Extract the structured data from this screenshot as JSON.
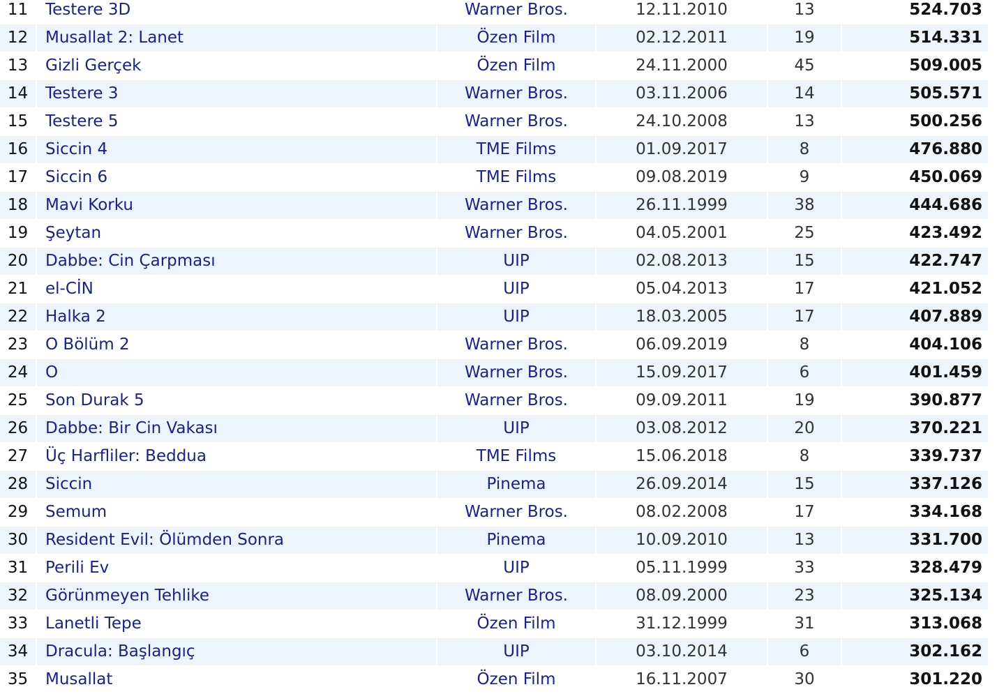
{
  "table": {
    "rows": [
      {
        "rank": "11",
        "title": "Testere 3D",
        "distributor": "Warner Bros.",
        "date": "12.11.2010",
        "weeks": "13",
        "admissions": "524.703"
      },
      {
        "rank": "12",
        "title": "Musallat 2: Lanet",
        "distributor": "Özen Film",
        "date": "02.12.2011",
        "weeks": "19",
        "admissions": "514.331"
      },
      {
        "rank": "13",
        "title": "Gizli Gerçek",
        "distributor": "Özen Film",
        "date": "24.11.2000",
        "weeks": "45",
        "admissions": "509.005"
      },
      {
        "rank": "14",
        "title": "Testere 3",
        "distributor": "Warner Bros.",
        "date": "03.11.2006",
        "weeks": "14",
        "admissions": "505.571"
      },
      {
        "rank": "15",
        "title": "Testere 5",
        "distributor": "Warner Bros.",
        "date": "24.10.2008",
        "weeks": "13",
        "admissions": "500.256"
      },
      {
        "rank": "16",
        "title": "Siccin 4",
        "distributor": "TME Films",
        "date": "01.09.2017",
        "weeks": "8",
        "admissions": "476.880"
      },
      {
        "rank": "17",
        "title": "Siccin 6",
        "distributor": "TME Films",
        "date": "09.08.2019",
        "weeks": "9",
        "admissions": "450.069"
      },
      {
        "rank": "18",
        "title": "Mavi Korku",
        "distributor": "Warner Bros.",
        "date": "26.11.1999",
        "weeks": "38",
        "admissions": "444.686"
      },
      {
        "rank": "19",
        "title": "Şeytan",
        "distributor": "Warner Bros.",
        "date": "04.05.2001",
        "weeks": "25",
        "admissions": "423.492"
      },
      {
        "rank": "20",
        "title": "Dabbe: Cin Çarpması",
        "distributor": "UIP",
        "date": "02.08.2013",
        "weeks": "15",
        "admissions": "422.747"
      },
      {
        "rank": "21",
        "title": "el-CİN",
        "distributor": "UIP",
        "date": "05.04.2013",
        "weeks": "17",
        "admissions": "421.052"
      },
      {
        "rank": "22",
        "title": "Halka 2",
        "distributor": "UIP",
        "date": "18.03.2005",
        "weeks": "17",
        "admissions": "407.889"
      },
      {
        "rank": "23",
        "title": "O Bölüm 2",
        "distributor": "Warner Bros.",
        "date": "06.09.2019",
        "weeks": "8",
        "admissions": "404.106"
      },
      {
        "rank": "24",
        "title": "O",
        "distributor": "Warner Bros.",
        "date": "15.09.2017",
        "weeks": "6",
        "admissions": "401.459"
      },
      {
        "rank": "25",
        "title": "Son Durak 5",
        "distributor": "Warner Bros.",
        "date": "09.09.2011",
        "weeks": "19",
        "admissions": "390.877"
      },
      {
        "rank": "26",
        "title": "Dabbe: Bir Cin Vakası",
        "distributor": "UIP",
        "date": "03.08.2012",
        "weeks": "20",
        "admissions": "370.221"
      },
      {
        "rank": "27",
        "title": "Üç Harfliler: Beddua",
        "distributor": "TME Films",
        "date": "15.06.2018",
        "weeks": "8",
        "admissions": "339.737"
      },
      {
        "rank": "28",
        "title": "Siccin",
        "distributor": "Pinema",
        "date": "26.09.2014",
        "weeks": "15",
        "admissions": "337.126"
      },
      {
        "rank": "29",
        "title": "Semum",
        "distributor": "Warner Bros.",
        "date": "08.02.2008",
        "weeks": "17",
        "admissions": "334.168"
      },
      {
        "rank": "30",
        "title": "Resident Evil: Ölümden Sonra",
        "distributor": "Pinema",
        "date": "10.09.2010",
        "weeks": "13",
        "admissions": "331.700"
      },
      {
        "rank": "31",
        "title": "Perili Ev",
        "distributor": "UIP",
        "date": "05.11.1999",
        "weeks": "33",
        "admissions": "328.479"
      },
      {
        "rank": "32",
        "title": "Görünmeyen Tehlike",
        "distributor": "Warner Bros.",
        "date": "08.09.2000",
        "weeks": "23",
        "admissions": "325.134"
      },
      {
        "rank": "33",
        "title": "Lanetli Tepe",
        "distributor": "Özen Film",
        "date": "31.12.1999",
        "weeks": "31",
        "admissions": "313.068"
      },
      {
        "rank": "34",
        "title": "Dracula: Başlangıç",
        "distributor": "UIP",
        "date": "03.10.2014",
        "weeks": "6",
        "admissions": "302.162"
      },
      {
        "rank": "35",
        "title": "Musallat",
        "distributor": "Özen Film",
        "date": "16.11.2007",
        "weeks": "30",
        "admissions": "301.220"
      }
    ]
  },
  "colors": {
    "link": "#1a237e",
    "stripe": "#eef4fc",
    "text": "#333333"
  }
}
